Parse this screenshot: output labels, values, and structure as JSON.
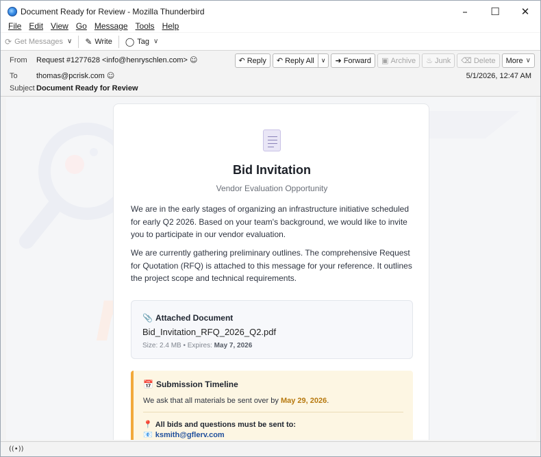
{
  "window": {
    "title": "Document Ready for Review - Mozilla Thunderbird"
  },
  "menu": [
    "File",
    "Edit",
    "View",
    "Go",
    "Message",
    "Tools",
    "Help"
  ],
  "toolbar": {
    "get_messages": "Get Messages",
    "write": "Write",
    "tag": "Tag"
  },
  "header": {
    "from_label": "From",
    "from_value": "Request #1277628 <info@henryschlen.com>",
    "to_label": "To",
    "to_value": "thomas@pcrisk.com",
    "subject_label": "Subject",
    "subject_value": "Document Ready for Review",
    "date": "5/1/2026, 12:47 AM",
    "buttons": {
      "reply": "Reply",
      "reply_all": "Reply All",
      "forward": "Forward",
      "archive": "Archive",
      "junk": "Junk",
      "delete": "Delete",
      "more": "More"
    }
  },
  "email": {
    "title": "Bid Invitation",
    "subtitle": "Vendor Evaluation Opportunity",
    "para1": "We are in the early stages of organizing an infrastructure initiative scheduled for early Q2 2026. Based on your team's background, we would like to invite you to participate in our vendor evaluation.",
    "para2": "We are currently gathering preliminary outlines. The comprehensive Request for Quotation (RFQ) is attached to this message for your reference. It outlines the project scope and technical requirements.",
    "attachment": {
      "title": "Attached Document",
      "filename": "Bid_Invitation_RFQ_2026_Q2.pdf",
      "size": "Size: 2.4 MB",
      "sep": " • Expires: ",
      "expires": "May 7, 2026"
    },
    "timeline": {
      "title": "Submission Timeline",
      "text": "We ask that all materials be sent over by ",
      "deadline": "May 29, 2026",
      "text_end": ".",
      "note": "All bids and questions must be sent to:",
      "contact": "ksmith@gflerv.com"
    }
  },
  "watermark": "risk.com",
  "colors": {
    "accent": "#f2a93b",
    "link": "#1f4f9c",
    "deadline": "#b7790f"
  }
}
